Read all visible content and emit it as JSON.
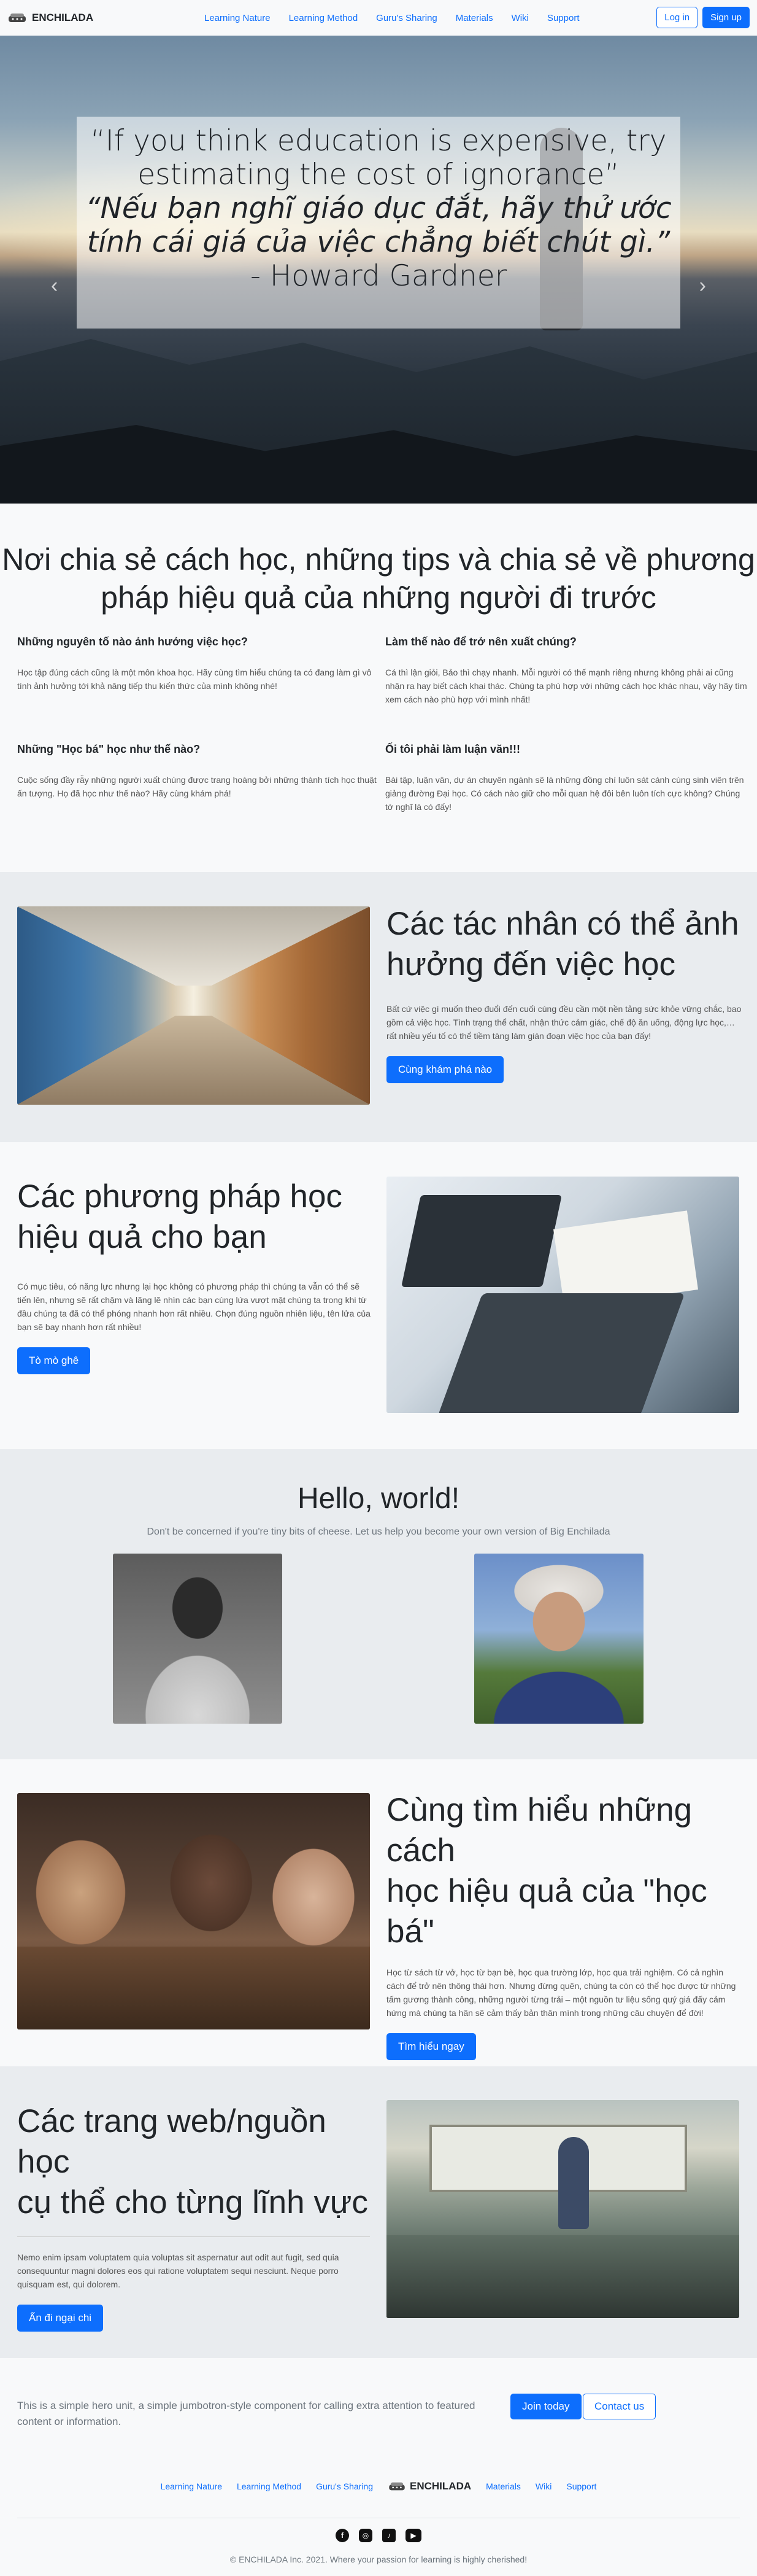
{
  "nav": {
    "brand": "ENCHILADA",
    "links": [
      "Learning Nature",
      "Learning Method",
      "Guru's Sharing",
      "Materials",
      "Wiki",
      "Support"
    ],
    "login": "Log in",
    "signup": "Sign up"
  },
  "hero": {
    "quote_en_line1": "“If you think education is expensive, try",
    "quote_en_line2": "estimating the cost of ignorance”",
    "quote_vi_line1": "“Nếu bạn nghĩ giáo dục đắt, hãy thử ước",
    "quote_vi_line2": "tính cái giá của việc chẳng biết chút gì.”",
    "author": "- Howard Gardner",
    "prev_icon": "‹",
    "next_icon": "›"
  },
  "features": {
    "title_line1": "Nơi chia sẻ cách học, những tips và chia sẻ về phương",
    "title_line2": "pháp hiệu quả của những người đi trước",
    "items": [
      {
        "heading": "Những nguyên tố nào ảnh hưởng việc học?",
        "text": "Học tập đúng cách cũng là một môn khoa học. Hãy cùng tìm hiểu chúng ta có đang làm gì vô tình ảnh hưởng tới khả năng tiếp thu kiến thức của mình không nhé!"
      },
      {
        "heading": "Làm thế nào để trở nên xuất chúng?",
        "text": "Cá thì lận giỏi, Bảo thì chạy nhanh. Mỗi người có thế mạnh riêng nhưng không phải ai cũng nhận ra hay biết cách khai thác. Chúng ta phù hợp với những cách học khác nhau, vậy hãy tìm xem cách nào phù hợp với mình nhất!"
      },
      {
        "heading": "Những \"Học bá\" học như thế nào?",
        "text": "Cuộc sống đầy rẫy những người xuất chúng được trang hoàng bởi những thành tích học thuật ấn tượng. Họ đã học như thế nào? Hãy cùng khám phá!"
      },
      {
        "heading": "Ối tôi phải làm luận văn!!!",
        "text": "Bài tập, luận văn, dự án chuyên ngành sẽ là những đồng chí luôn sát cánh cùng sinh viên trên giảng đường Đại học. Có cách nào giữ cho mỗi quan hệ đôi bên luôn tích cực không? Chúng tớ nghĩ là có đấy!"
      }
    ]
  },
  "factors": {
    "title_line1": "Các tác nhân có thể ảnh",
    "title_line2": "hưởng đến việc học",
    "text": "Bất cứ việc gì muốn theo đuổi đến cuối cùng đều cần một nền tảng sức khỏe vững chắc, bao gồm cả việc học. Tình trạng thể chất, nhận thức cảm giác, chế độ ăn uống, động lực học,… rất nhiều yếu tố có thể tiềm tàng làm gián đoạn việc học của bạn đấy!",
    "button": "Cùng khám phá nào"
  },
  "methods": {
    "title_line1": "Các phương pháp học",
    "title_line2": "hiệu quả cho bạn",
    "text": "Có mục tiêu, có năng lực nhưng lại học không có phương pháp thì chúng ta vẫn có thể sẽ tiến lên, nhưng sẽ rất chậm và lãng lẽ nhìn các bạn cùng lứa vượt mặt chúng ta trong khi từ đầu chúng ta đã có thể phóng nhanh hơn rất nhiều. Chọn đúng nguồn nhiên liệu, tên lửa của bạn sẽ bay nhanh hơn rất nhiều!",
    "button": "Tò mò ghê"
  },
  "hello": {
    "title": "Hello, world!",
    "subtitle": "Don't be concerned if you're tiny bits of cheese. Let us help you become your own version of Big Enchilada"
  },
  "scholars": {
    "title_line1": "Cùng tìm hiểu những cách",
    "title_line2": "học hiệu quả của \"học bá\"",
    "text": "Học từ sách từ vở, học từ bạn bè, học qua trường lớp, học qua trải nghiệm. Có cả nghìn cách để trở nên thông thái hơn. Nhưng đừng quên, chúng ta còn có thể học được từ những tấm gương thành công, những người từng trải – một nguồn tư liệu sống quý giá đấy cảm hứng mà chúng ta hãn sẽ cảm thấy bản thân mình trong những câu chuyện để đời!",
    "button": "Tìm hiểu ngay"
  },
  "resources": {
    "title_line1": "Các trang web/nguồn học",
    "title_line2": "cụ thể cho từng lĩnh vực",
    "text": "Nemo enim ipsam voluptatem quia voluptas sit aspernatur aut odit aut fugit, sed quia consequuntur magni dolores eos qui ratione voluptatem sequi nesciunt. Neque porro quisquam est, qui dolorem.",
    "button": "Ấn đi ngại chi"
  },
  "cta": {
    "text": "This is a simple hero unit, a simple jumbotron-style component for calling extra attention to featured content or information.",
    "join": "Join today",
    "contact": "Contact us"
  },
  "footer": {
    "links_left": [
      "Learning Nature",
      "Learning Method",
      "Guru's Sharing"
    ],
    "brand": "ENCHILADA",
    "links_right": [
      "Materials",
      "Wiki",
      "Support"
    ],
    "socials": [
      "facebook-icon",
      "instagram-icon",
      "tiktok-icon",
      "youtube-icon"
    ],
    "copyright": "© ENCHILADA Inc. 2021. Where your passion for learning is highly cherished!"
  },
  "colors": {
    "primary": "#0d6efd",
    "band_gray": "#e9ecef",
    "background": "#f8f9fa"
  }
}
